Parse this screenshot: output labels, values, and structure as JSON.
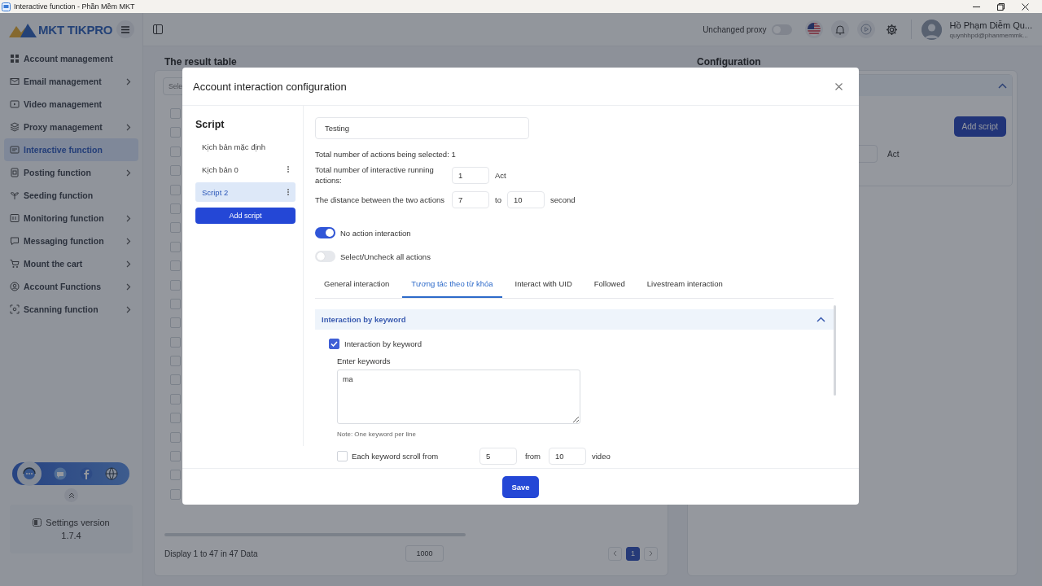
{
  "window": {
    "title": "Interactive function - Phần Mềm MKT"
  },
  "topbar": {
    "logo": "MKT TIKPRO",
    "proxy_label": "Unchanged proxy",
    "proxy_on": false,
    "user_name": "Hồ Phạm Diễm Qu...",
    "user_email": "quynhhpd@phanmemmk..."
  },
  "sidebar": {
    "items": [
      {
        "label": "Account management",
        "selected": false,
        "submenu": false
      },
      {
        "label": "Email management",
        "selected": false,
        "submenu": true
      },
      {
        "label": "Video management",
        "selected": false,
        "submenu": false
      },
      {
        "label": "Proxy management",
        "selected": false,
        "submenu": true
      },
      {
        "label": "Interactive function",
        "selected": true,
        "submenu": false
      },
      {
        "label": "Posting function",
        "selected": false,
        "submenu": true
      },
      {
        "label": "Seeding function",
        "selected": false,
        "submenu": false
      },
      {
        "label": "Monitoring function",
        "selected": false,
        "submenu": true
      },
      {
        "label": "Messaging function",
        "selected": false,
        "submenu": true
      },
      {
        "label": "Mount the cart",
        "selected": false,
        "submenu": true
      },
      {
        "label": "Account Functions",
        "selected": false,
        "submenu": true
      },
      {
        "label": "Scanning function",
        "selected": false,
        "submenu": true
      }
    ],
    "settings": {
      "label": "Settings version",
      "version": "1.7.4"
    }
  },
  "result_table": {
    "title": "The result table",
    "select_placeholder": "Sele",
    "rows": [
      {
        "checked": false
      },
      {
        "checked": false
      },
      {
        "checked": false
      },
      {
        "checked": false
      },
      {
        "checked": false
      },
      {
        "checked": false
      },
      {
        "checked": false
      },
      {
        "checked": false
      },
      {
        "checked": false
      },
      {
        "checked": false
      },
      {
        "checked": false
      },
      {
        "checked": false
      },
      {
        "checked": false
      },
      {
        "checked": false
      },
      {
        "checked": false
      },
      {
        "checked": false
      },
      {
        "checked": false
      },
      {
        "checked": false
      },
      {
        "checked": false
      },
      {
        "checked": false
      },
      {
        "checked": false
      }
    ],
    "footer": "Display 1 to 47 in 47 Data",
    "page_size": "1000",
    "pages": [
      {
        "label": "1",
        "selected": true
      }
    ]
  },
  "configuration": {
    "title": "Configuration",
    "expanded": true,
    "add_script": "Add script",
    "unit": "Act"
  },
  "modal": {
    "title": "Account interaction configuration",
    "scripts_title": "Script",
    "scripts": [
      {
        "label": "Kịch bản mặc định",
        "selected": false,
        "menu": false
      },
      {
        "label": "Kịch bản 0",
        "selected": false,
        "menu": true
      },
      {
        "label": "Script 2",
        "selected": true,
        "menu": true
      }
    ],
    "add_script": "Add script",
    "name": "Testing",
    "selected_count": "Total number of actions being selected: 1",
    "running": {
      "label": "Total number of interactive running actions:",
      "value": "1",
      "unit": "Act"
    },
    "distance": {
      "label": "The distance between the two actions",
      "from": "7",
      "to_word": "to",
      "to": "10",
      "unit": "second"
    },
    "toggles": [
      {
        "label": "No action interaction",
        "on": true
      },
      {
        "label": "Select/Uncheck all actions",
        "on": false
      }
    ],
    "tabs": [
      {
        "label": "General interaction",
        "selected": false
      },
      {
        "label": "Tương tác theo từ khóa",
        "selected": true
      },
      {
        "label": "Interact with UID",
        "selected": false
      },
      {
        "label": "Followed",
        "selected": false
      },
      {
        "label": "Livestream interaction",
        "selected": false
      }
    ],
    "section": {
      "title": "Interaction by keyword",
      "expanded": true,
      "checkbox": {
        "label": "Interaction by keyword",
        "checked": true
      },
      "keywords_label": "Enter keywords",
      "keywords": "ma",
      "note": "Note: One keyword per line",
      "scroll": {
        "checked": false,
        "label": "Each keyword scroll from",
        "from": "5",
        "from_word": "from",
        "to": "10",
        "unit": "video"
      }
    },
    "save": "Save"
  }
}
